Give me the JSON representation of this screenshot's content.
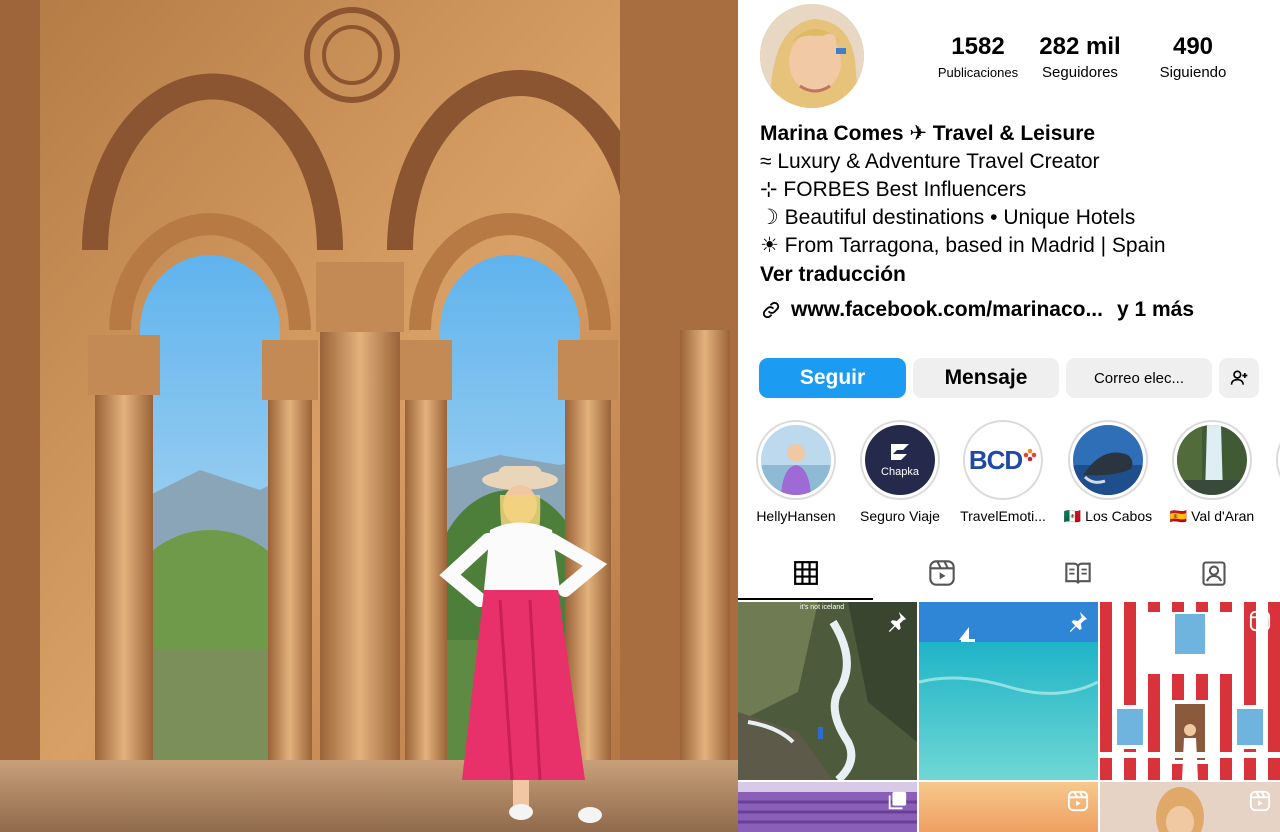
{
  "photo": {
    "alt_icon": "archway-photo"
  },
  "profile": {
    "stats": [
      {
        "value": "1582",
        "label": "Publicaciones"
      },
      {
        "value": "282 mil",
        "label": "Seguidores"
      },
      {
        "value": "490",
        "label": "Siguiendo"
      }
    ],
    "name": "Marina Comes ✈ Travel & Leisure",
    "bio_lines": [
      "≈ Luxury & Adventure Travel Creator",
      "⊹ FORBES Best Influencers",
      "☽ Beautiful destinations • Unique Hotels",
      "☀ From Tarragona, based in Madrid | Spain"
    ],
    "translate": "Ver traducción",
    "link_text": "www.facebook.com/marinaco...",
    "link_more": "y 1 más",
    "buttons": {
      "follow": "Seguir",
      "message": "Mensaje",
      "email": "Correo elec..."
    },
    "highlights": [
      {
        "label": "HellyHansen"
      },
      {
        "label": "Seguro Viaje",
        "logo_text": "Chapka"
      },
      {
        "label": "TravelEmoti...",
        "logo_text": "BCD"
      },
      {
        "label": "🇲🇽 Los Cabos"
      },
      {
        "label": "🇪🇸 Val d'Aran"
      }
    ],
    "tabs": [
      "grid-icon",
      "reels-icon",
      "guides-icon",
      "tagged-icon"
    ],
    "grid_overlay_text": "it's not iceland",
    "colors": {
      "follow": "#1b9cf2",
      "button_gray": "#efefef"
    }
  }
}
